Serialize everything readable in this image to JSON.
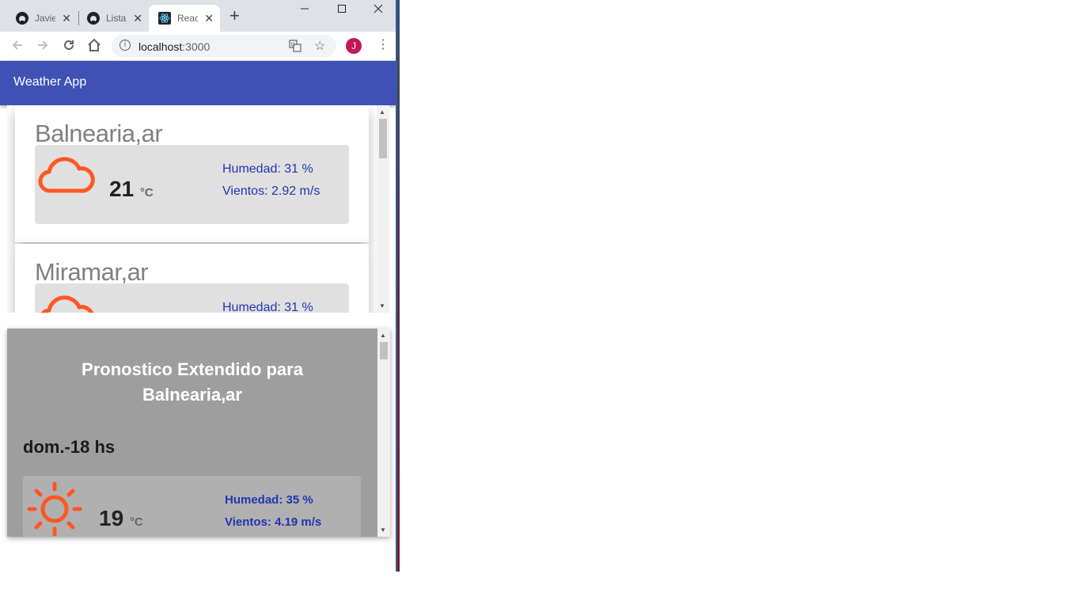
{
  "browser": {
    "tabs": [
      {
        "title": "Javie",
        "icon": "github-icon"
      },
      {
        "title": "Lista",
        "icon": "github-icon"
      },
      {
        "title": "Reac",
        "icon": "react-icon",
        "active": true
      }
    ],
    "new_tab": "+",
    "address": {
      "host": "localhost",
      "port": ":3000"
    },
    "profile_initial": "J"
  },
  "app": {
    "title": "Weather App",
    "accent_color": "#3f51b5",
    "icon_color": "#ff5722"
  },
  "locations": [
    {
      "city": "Balnearia,ar",
      "icon": "cloud-icon",
      "temperature": "21",
      "unit": "°C",
      "humidity": "Humedad: 31 %",
      "wind": "Vientos: 2.92 m/s"
    },
    {
      "city": "Miramar,ar",
      "icon": "cloud-icon",
      "temperature": "",
      "unit": "",
      "humidity": "Humedad: 31 %",
      "wind": ""
    }
  ],
  "forecast": {
    "title_line1": "Pronostico Extendido para",
    "title_line2": "Balnearia,ar",
    "items": [
      {
        "day": "dom.-18 hs",
        "icon": "sun-icon",
        "temperature": "19",
        "unit": "°C",
        "humidity": "Humedad: 35 %",
        "wind": "Vientos: 4.19 m/s"
      }
    ]
  }
}
